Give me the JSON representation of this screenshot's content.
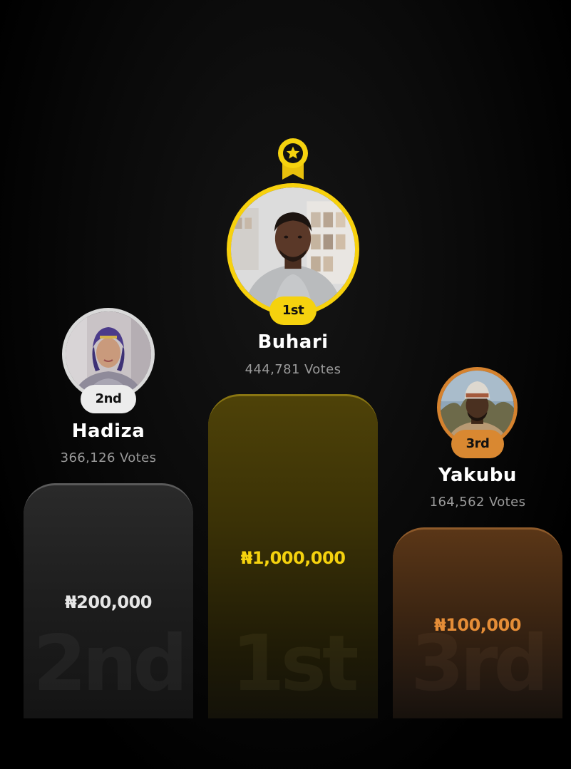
{
  "currency_symbol": "₦",
  "leaderboard": {
    "first": {
      "rank_label": "1st",
      "name": "Buhari",
      "votes": "444,781 Votes",
      "prize": "₦1,000,000",
      "podium_label": "1st",
      "accent_color": "#f5d20e"
    },
    "second": {
      "rank_label": "2nd",
      "name": "Hadiza",
      "votes": "366,126 Votes",
      "prize": "₦200,000",
      "podium_label": "2nd",
      "accent_color": "#d9d9d9"
    },
    "third": {
      "rank_label": "3rd",
      "name": "Yakubu",
      "votes": "164,562 Votes",
      "prize": "₦100,000",
      "podium_label": "3rd",
      "accent_color": "#d98831"
    }
  },
  "icons": {
    "winner_medal": "star-medal-icon"
  }
}
